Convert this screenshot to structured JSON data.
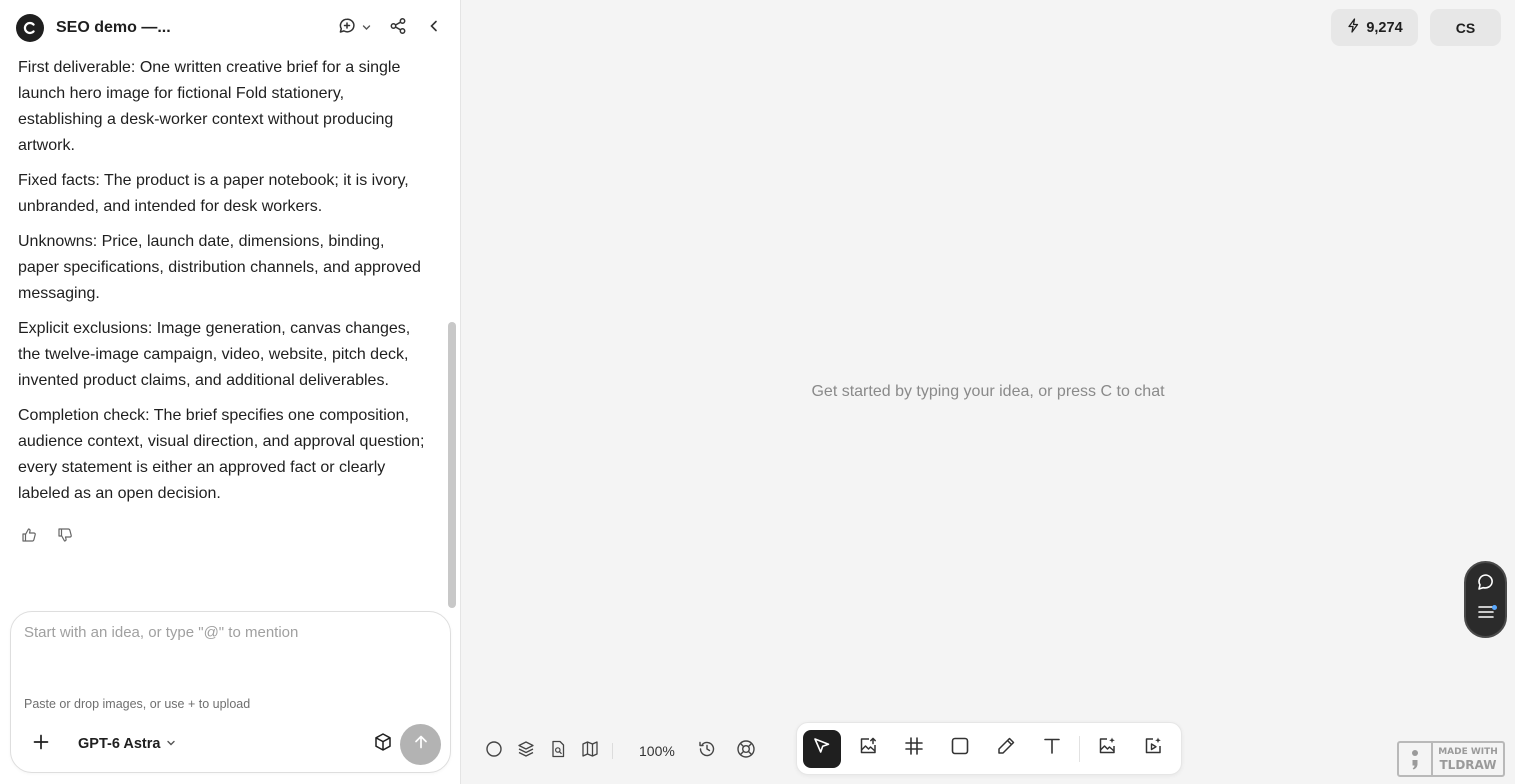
{
  "header": {
    "title": "SEO demo —..."
  },
  "messages": [
    "First deliverable: One written creative brief for a single launch hero image for fictional Fold stationery, establishing a desk-worker context without producing artwork.",
    "Fixed facts: The product is a paper notebook; it is ivory, unbranded, and intended for desk workers.",
    "Unknowns: Price, launch date, dimensions, binding, paper specifications, distribution channels, and approved messaging.",
    "Explicit exclusions: Image generation, canvas changes, the twelve-image campaign, video, website, pitch deck, invented product claims, and additional deliverables.",
    "Completion check: The brief specifies one composition, audience context, visual direction, and approval question; every statement is either an approved fact or clearly labeled as an open decision."
  ],
  "composer": {
    "placeholder": "Start with an idea, or type \"@\" to mention",
    "hint": "Paste or drop images, or use + to upload",
    "model": "GPT-6 Astra"
  },
  "topbar": {
    "credits": "9,274",
    "avatar_initials": "CS"
  },
  "canvas": {
    "empty_hint": "Get started by typing your idea, or press C to chat",
    "zoom": "100%"
  },
  "watermark": {
    "line1": "MADE WITH",
    "line2": "TLDRAW"
  },
  "colors": {
    "accent_dark": "#1f1f1f",
    "canvas_bg": "#f4f4f4",
    "send_disabled": "#b3b3b3",
    "notification_dot": "#5aa9ff"
  }
}
